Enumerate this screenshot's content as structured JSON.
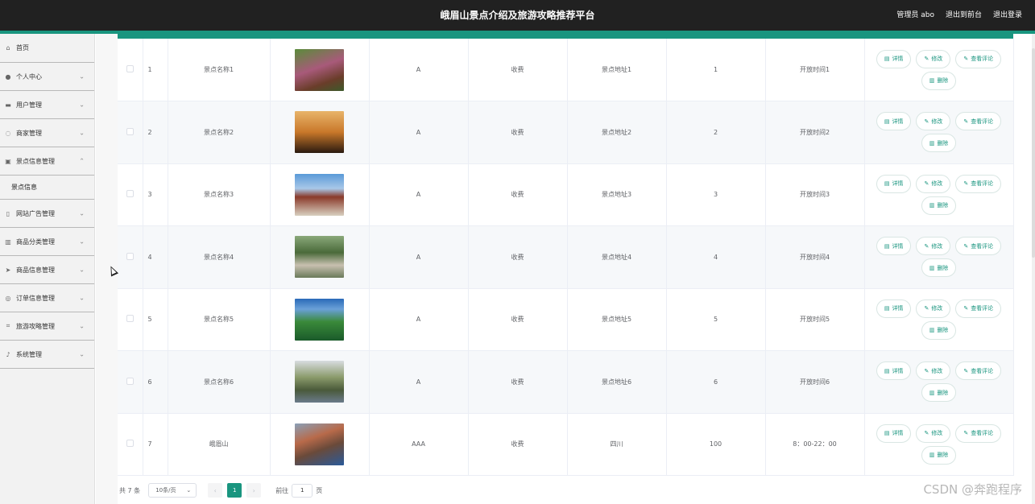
{
  "header": {
    "title": "峨眉山景点介绍及旅游攻略推荐平台",
    "admin_label": "管理员 abo",
    "front_link": "退出到前台",
    "logout_link": "退出登录",
    "accent_color": "#19957f",
    "bar_color": "#212121"
  },
  "sidebar": {
    "home": "首页",
    "items": [
      {
        "label": "个人中心",
        "icon": "person-icon",
        "chev": "⌄"
      },
      {
        "label": "用户管理",
        "icon": "monitor-icon",
        "chev": "⌄"
      },
      {
        "label": "商家管理",
        "icon": "power-icon",
        "chev": "⌄"
      },
      {
        "label": "景点信息管理",
        "icon": "image-icon",
        "chev": "⌃"
      }
    ],
    "sub_item": "景点信息",
    "items_after": [
      {
        "label": "网站广告管理",
        "icon": "phone-icon",
        "chev": "⌄"
      },
      {
        "label": "商品分类管理",
        "icon": "chart-icon",
        "chev": "⌄"
      },
      {
        "label": "商品信息管理",
        "icon": "send-icon",
        "chev": "⌄"
      },
      {
        "label": "订单信息管理",
        "icon": "circle-icon",
        "chev": "⌄"
      },
      {
        "label": "旅游攻略管理",
        "icon": "crop-icon",
        "chev": "⌄"
      },
      {
        "label": "系统管理",
        "icon": "mic-icon",
        "chev": "⌄"
      }
    ]
  },
  "actions": {
    "detail": "详情",
    "edit": "修改",
    "comments": "查看评论",
    "delete": "删除"
  },
  "rows": [
    {
      "index": "1",
      "name": "景点名称1",
      "level": "A",
      "fee": "收费",
      "address": "景点地址1",
      "num": "1",
      "hours": "开放时间1"
    },
    {
      "index": "2",
      "name": "景点名称2",
      "level": "A",
      "fee": "收费",
      "address": "景点地址2",
      "num": "2",
      "hours": "开放时间2"
    },
    {
      "index": "3",
      "name": "景点名称3",
      "level": "A",
      "fee": "收费",
      "address": "景点地址3",
      "num": "3",
      "hours": "开放时间3"
    },
    {
      "index": "4",
      "name": "景点名称4",
      "level": "A",
      "fee": "收费",
      "address": "景点地址4",
      "num": "4",
      "hours": "开放时间4"
    },
    {
      "index": "5",
      "name": "景点名称5",
      "level": "A",
      "fee": "收费",
      "address": "景点地址5",
      "num": "5",
      "hours": "开放时间5"
    },
    {
      "index": "6",
      "name": "景点名称6",
      "level": "A",
      "fee": "收费",
      "address": "景点地址6",
      "num": "6",
      "hours": "开放时间6"
    },
    {
      "index": "7",
      "name": "峨眉山",
      "level": "AAA",
      "fee": "收费",
      "address": "四川",
      "num": "100",
      "hours": "8：00-22：00"
    }
  ],
  "pagination": {
    "total": "共 7 条",
    "page_size": "10条/页",
    "current_page": "1",
    "goto_label": "前往",
    "goto_value": "1",
    "page_suffix": "页"
  },
  "watermark": "CSDN @奔跑程序"
}
